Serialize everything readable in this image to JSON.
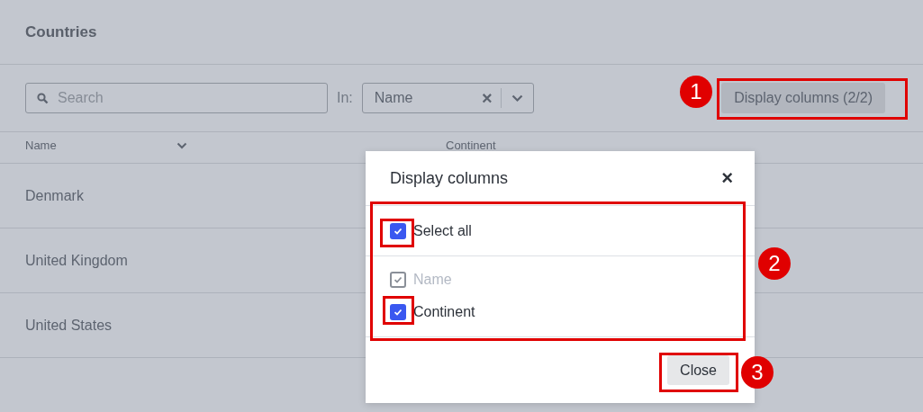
{
  "page": {
    "title": "Countries"
  },
  "toolbar": {
    "search_placeholder": "Search",
    "in_label": "In:",
    "in_value": "Name",
    "clear_glyph": "×",
    "display_button": "Display columns (2/2)"
  },
  "table": {
    "columns": [
      {
        "label": "Name",
        "sortable": true
      },
      {
        "label": "Continent",
        "sortable": false
      }
    ],
    "rows": [
      {
        "name": "Denmark"
      },
      {
        "name": "United Kingdom"
      },
      {
        "name": "United States"
      }
    ]
  },
  "dialog": {
    "title": "Display columns",
    "close_glyph": "×",
    "select_all": {
      "label": "Select all",
      "checked": true,
      "disabled": false
    },
    "columns": [
      {
        "label": "Name",
        "checked": true,
        "disabled": true
      },
      {
        "label": "Continent",
        "checked": true,
        "disabled": false
      }
    ],
    "close_button": "Close"
  },
  "annotations": [
    {
      "kind": "numbered",
      "number": "1"
    },
    {
      "kind": "numbered",
      "number": "2"
    },
    {
      "kind": "plain"
    },
    {
      "kind": "plain"
    },
    {
      "kind": "numbered",
      "number": "3"
    }
  ]
}
